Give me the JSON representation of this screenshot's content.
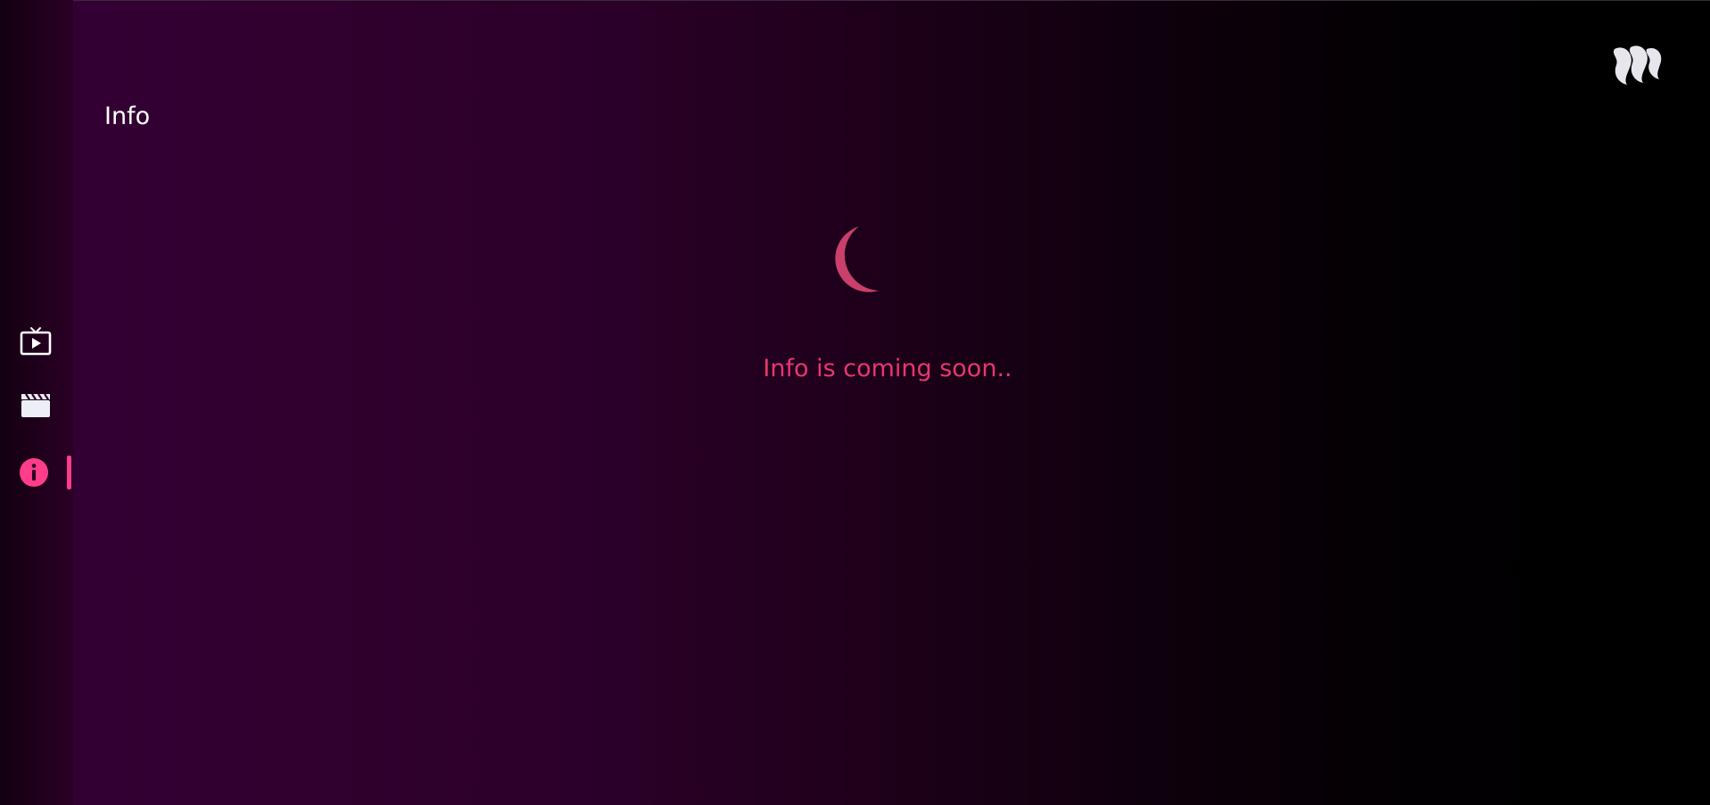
{
  "page": {
    "title": "Info"
  },
  "sidebar": {
    "items": [
      {
        "name": "live-tv",
        "icon": "tv-play-icon",
        "active": false
      },
      {
        "name": "movies",
        "icon": "clapperboard-icon",
        "active": false
      },
      {
        "name": "info",
        "icon": "info-icon",
        "active": true
      }
    ]
  },
  "main": {
    "status_text": "Info is coming soon.."
  },
  "colors": {
    "accent": "#ff3d8a",
    "status_text": "#e7376f",
    "spinner": "#d3436f",
    "background_left": "#330034",
    "background_right": "#000000"
  }
}
